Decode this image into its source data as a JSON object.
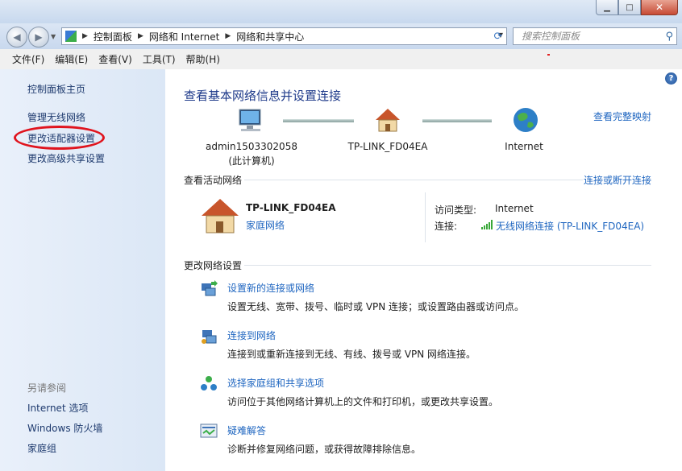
{
  "window": {
    "min_label": "▁",
    "max_label": "□",
    "close_label": "✕"
  },
  "address": {
    "crumbs": [
      "控制面板",
      "网络和 Internet",
      "网络和共享中心"
    ],
    "search_placeholder": "搜索控制面板"
  },
  "menu": [
    "文件(F)",
    "编辑(E)",
    "查看(V)",
    "工具(T)",
    "帮助(H)"
  ],
  "sidebar": {
    "items": [
      "控制面板主页",
      "管理无线网络",
      "更改适配器设置",
      "更改高级共享设置"
    ],
    "see_also_title": "另请参阅",
    "see_also": [
      "Internet 选项",
      "Windows 防火墙",
      "家庭组"
    ]
  },
  "main": {
    "title": "查看基本网络信息并设置连接",
    "full_map": "查看完整映射",
    "nodes": [
      {
        "name": "admin1503302058",
        "sub": "(此计算机)"
      },
      {
        "name": "TP-LINK_FD04EA"
      },
      {
        "name": "Internet"
      }
    ],
    "active_title": "查看活动网络",
    "connect_disconnect": "连接或断开连接",
    "network_name": "TP-LINK_FD04EA",
    "network_type": "家庭网络",
    "access_type_label": "访问类型:",
    "access_type_value": "Internet",
    "connection_label": "连接:",
    "connection_value": "无线网络连接 (TP-LINK_FD04EA)",
    "change_title": "更改网络设置",
    "tasks": [
      {
        "title": "设置新的连接或网络",
        "desc": "设置无线、宽带、拨号、临时或 VPN 连接；或设置路由器或访问点。"
      },
      {
        "title": "连接到网络",
        "desc": "连接到或重新连接到无线、有线、拨号或 VPN 网络连接。"
      },
      {
        "title": "选择家庭组和共享选项",
        "desc": "访问位于其他网络计算机上的文件和打印机，或更改共享设置。"
      },
      {
        "title": "疑难解答",
        "desc": "诊断并修复网络问题，或获得故障排除信息。"
      }
    ],
    "help_label": "?"
  }
}
